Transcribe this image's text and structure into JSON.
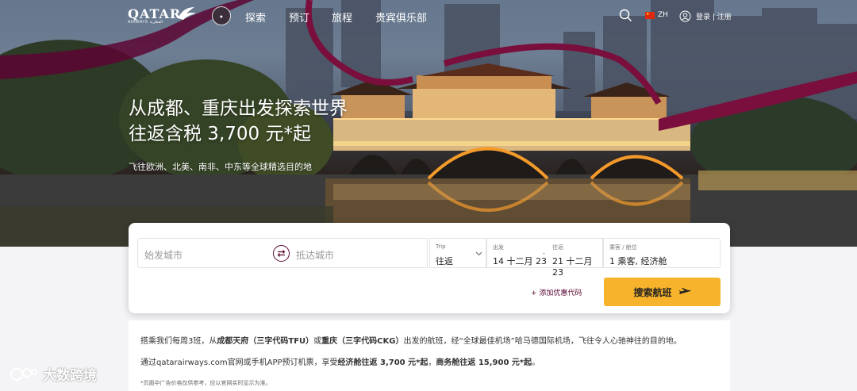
{
  "nav": {
    "logo_text": "QATAR",
    "logo_sub": "AIRWAYS القطرية",
    "links": [
      "探索",
      "预订",
      "旅程",
      "贵宾俱乐部"
    ],
    "lang": "ZH",
    "login": "登录 | 注册"
  },
  "hero": {
    "title_line1": "从成都、重庆出发探索世界",
    "title_line2": "往返含税 3,700 元*起",
    "subtitle": "飞往欧洲、北美、南非、中东等全球精选目的地"
  },
  "booking": {
    "origin_placeholder": "始发城市",
    "dest_placeholder": "抵达城市",
    "trip_label": "Trip",
    "trip_value": "往返",
    "depart_label": "出发",
    "depart_value": "14 十二月 23",
    "return_label": "往返",
    "return_value": "21 十二月 23",
    "pax_label": "乘客 / 舱位",
    "pax_value": "1 乘客, 经济舱",
    "promo": "+ 添加优惠代码",
    "search_button": "搜索航班"
  },
  "content": {
    "p1_a": "搭乘我们每周3班，从",
    "p1_b": "成都天府（三字代码TFU）",
    "p1_c": "或",
    "p1_d": "重庆（三字代码CKG）",
    "p1_e": "出发的航班，经“全球最佳机场”哈马德国际机场，飞往令人心驰神往的目的地。",
    "p2_a": "通过qatarairways.com官网或手机APP预订机票，享受",
    "p2_b": "经济舱往返 3,700 元*起",
    "p2_c": "，",
    "p2_d": "商务舱往返 15,900 元*起",
    "p2_e": "。",
    "p3": "*页面中广告价格仅供参考，应以官网实时显示为准。"
  },
  "watermark": "大数跨境",
  "colors": {
    "brand": "#5c0632",
    "button": "#f7b32b"
  },
  "icons": [
    "search-icon",
    "globe-flag-icon",
    "user-icon",
    "swap-icon",
    "chevron-down-icon",
    "plane-icon"
  ]
}
